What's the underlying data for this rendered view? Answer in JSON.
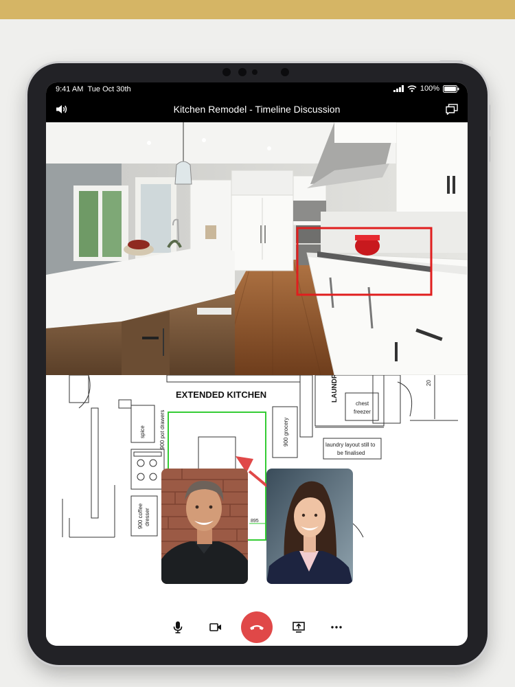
{
  "status_bar": {
    "time": "9:41 AM",
    "date": "Tue Oct 30th",
    "battery": "100%"
  },
  "call": {
    "title": "Kitchen Remodel - Timeline Discussion"
  },
  "blueprint": {
    "heading": "EXTENDED KITCHEN",
    "labels": {
      "pot_drawers": "900 pot drawers",
      "spice": "spice",
      "grocery": "900 grocery",
      "chest_freezer_1": "chest",
      "chest_freezer_2": "freezer",
      "laundry_1": "laundry layout still to",
      "laundry_2": "be finalised",
      "laundry_vertical": "LAUNDRY",
      "coffee_1": "900 coffee",
      "coffee_2": "dresser",
      "dim_895": "895",
      "dim_20": "20"
    }
  },
  "colors": {
    "accent_gold": "#d5b565",
    "end_call": "#e04848",
    "highlight_red": "#e01e1e",
    "highlight_green": "#33cc33"
  },
  "controls": {
    "icons": [
      "microphone-icon",
      "video-camera-icon",
      "hang-up-icon",
      "share-screen-icon",
      "more-icon"
    ]
  }
}
